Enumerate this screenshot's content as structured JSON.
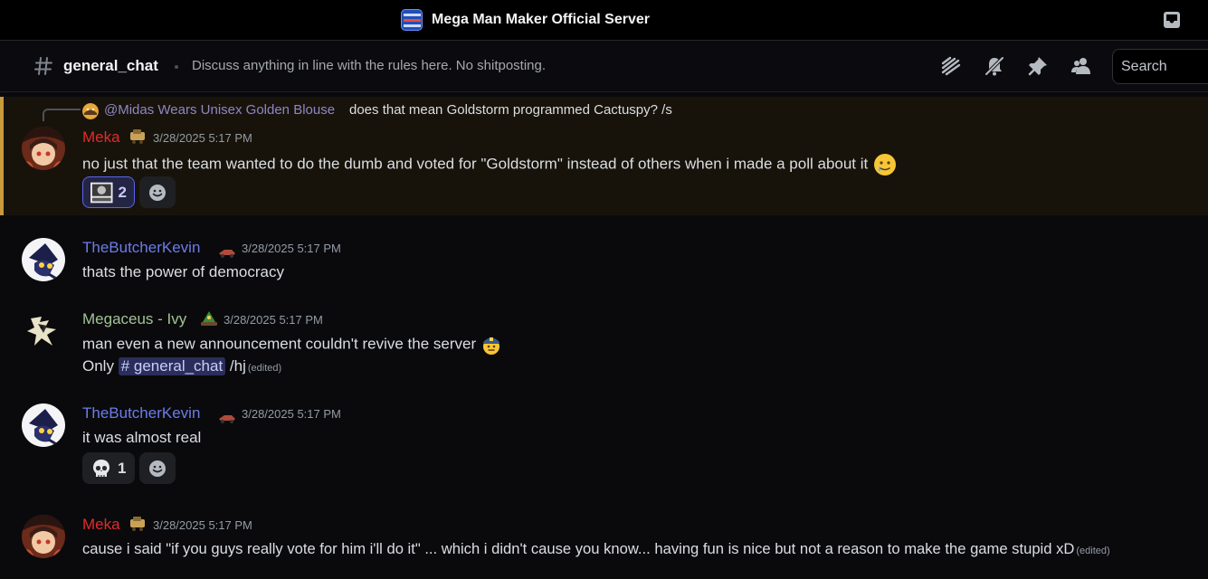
{
  "window": {
    "server_name": "Mega Man Maker Official Server"
  },
  "header": {
    "channel_name": "general_chat",
    "topic": "Discuss anything in line with the rules here. No shitposting.",
    "search_placeholder": "Search"
  },
  "reply": {
    "mention": "@Midas Wears Unisex Golden Blouse",
    "text": "does that mean Goldstorm programmed Cactuspy? /s"
  },
  "messages": [
    {
      "author": "Meka",
      "author_color": "#e02b2b",
      "timestamp": "3/28/2025 5:17 PM",
      "text": "no just that the team wanted to do the dumb and voted for \"Goldstorm\" instead of others when i made a poll about it",
      "reaction_count": "2"
    },
    {
      "author": "TheButcherKevin",
      "author_color": "#6c7ce7",
      "timestamp": "3/28/2025 5:17 PM",
      "text": "thats the power of democracy"
    },
    {
      "author": "Megaceus - Ivy",
      "author_color": "#a3c293",
      "timestamp": "3/28/2025 5:17 PM",
      "text": "man even a new announcement couldn't revive the server",
      "line2_prefix": "Only",
      "channel_mention": "# general_chat",
      "line2_suffix": "/hj",
      "edited": "(edited)"
    },
    {
      "author": "TheButcherKevin",
      "author_color": "#6c7ce7",
      "timestamp": "3/28/2025 5:17 PM",
      "text": "it was almost real",
      "reaction_count": "1"
    },
    {
      "author": "Meka",
      "author_color": "#e02b2b",
      "timestamp": "3/28/2025 5:17 PM",
      "text": "cause i said \"if you guys really vote for him i'll do it\" ... which i didn't cause you know... having fun is nice but not a reason to make the game stupid xD",
      "edited": "(edited)"
    }
  ],
  "icons": [
    "server-logo-icon",
    "inbox-icon",
    "hash-icon",
    "threads-icon",
    "notification-mute-icon",
    "pin-icon",
    "member-list-icon",
    "add-reaction-icon",
    "skull-emoji-icon",
    "sad-tear-emoji-icon",
    "police-emoji-icon"
  ]
}
